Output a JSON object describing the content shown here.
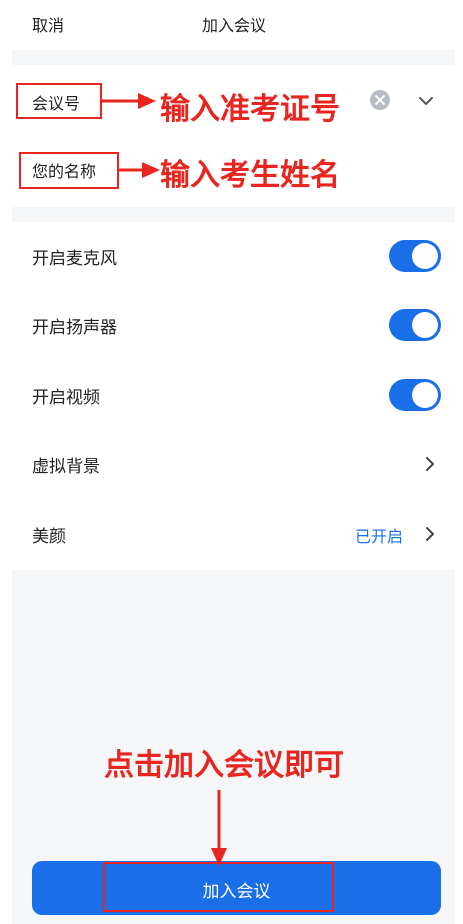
{
  "header": {
    "cancel_label": "取消",
    "title": "加入会议"
  },
  "inputs": {
    "meeting_id_label": "会议号",
    "name_label": "您的名称"
  },
  "settings": {
    "microphone": {
      "label": "开启麦克风",
      "on": true
    },
    "speaker": {
      "label": "开启扬声器",
      "on": true
    },
    "video": {
      "label": "开启视频",
      "on": true
    },
    "virtual_bg": {
      "label": "虚拟背景"
    },
    "beauty": {
      "label": "美颜",
      "status": "已开启"
    }
  },
  "join_button_label": "加入会议",
  "annotations": {
    "meeting_id_hint": "输入准考证号",
    "name_hint": "输入考生姓名",
    "join_hint": "点击加入会议即可"
  },
  "colors": {
    "accent": "#1a6ee8",
    "annotation": "#e8261f",
    "gray_bg": "#f5f6f8"
  }
}
